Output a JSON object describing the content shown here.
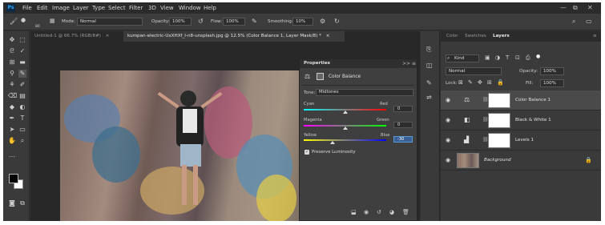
{
  "menubar": {
    "app_icon": "Ps",
    "items": [
      "File",
      "Edit",
      "Image",
      "Layer",
      "Type",
      "Select",
      "Filter",
      "3D",
      "View",
      "Window",
      "Help"
    ],
    "controls": [
      "—",
      "⧉",
      "✕"
    ]
  },
  "options_bar": {
    "brush_size": "80",
    "mode_label": "Mode:",
    "mode_value": "Normal",
    "opacity_label": "Opacity:",
    "opacity_value": "100%",
    "flow_label": "Flow:",
    "flow_value": "100%",
    "smoothing_label": "Smoothing:",
    "smoothing_value": "10%"
  },
  "document_tabs": [
    {
      "label": "Untitled-1 @ 66.7% (RGB/8#)",
      "close": "×",
      "active": false
    },
    {
      "label": "kumpan-electric-UxXHXf_I-n8-unsplash.jpg @ 12.5% (Color Balance 1, Layer Mask/8) *",
      "close": "×",
      "active": true
    }
  ],
  "properties_panel": {
    "title": "Properties",
    "header_icons": ">>  ≡",
    "section_title": "Color Balance",
    "tone_label": "Tone:",
    "tone_value": "Midtones",
    "sliders": [
      {
        "left": "Cyan",
        "right": "Red",
        "value": "0",
        "position": 0.5,
        "focused": false
      },
      {
        "left": "Magenta",
        "right": "Green",
        "value": "0",
        "position": 0.5,
        "focused": false
      },
      {
        "left": "Yellow",
        "right": "Blue",
        "value": "-30",
        "position": 0.35,
        "focused": true
      }
    ],
    "preserve_luminosity_label": "Preserve Luminosity",
    "preserve_luminosity_checked": true
  },
  "panel_tabs": {
    "color": "Color",
    "swatches": "Swatches",
    "layers": "Layers"
  },
  "layers_panel": {
    "kind_label": "Kind",
    "blend_mode": "Normal",
    "opacity_label": "Opacity:",
    "opacity_value": "100%",
    "lock_label": "Lock:",
    "fill_label": "Fill:",
    "fill_value": "100%",
    "layers": [
      {
        "name": "Color Balance 1",
        "type": "adjustment",
        "icon": "scale-icon",
        "selected": true
      },
      {
        "name": "Black & White 1",
        "type": "adjustment",
        "icon": "half-square-icon",
        "selected": false
      },
      {
        "name": "Levels 1",
        "type": "adjustment",
        "icon": "histogram-icon",
        "selected": false
      },
      {
        "name": "Background",
        "type": "image",
        "icon": "lock-icon",
        "selected": false
      }
    ]
  },
  "colors": {
    "app_bg": "#323232",
    "panel_bg": "#3a3a3a",
    "accent_blue": "#31a8ff",
    "foreground_swatch": "#000000",
    "background_swatch": "#ffffff"
  }
}
